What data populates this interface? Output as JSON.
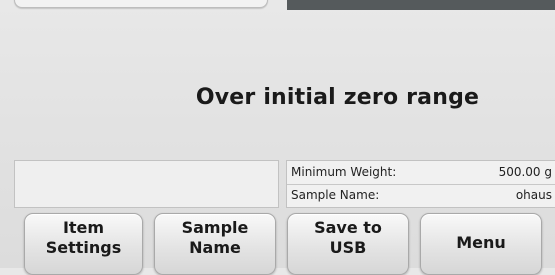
{
  "message": "Over initial zero range",
  "info": {
    "min_weight_label": "Minimum Weight:",
    "min_weight_value": "500.00 g",
    "sample_name_label": "Sample Name:",
    "sample_name_value": "ohaus"
  },
  "buttons": {
    "item_settings": "Item\nSettings",
    "sample_name": "Sample\nName",
    "save_usb": "Save to\nUSB",
    "menu": "Menu"
  }
}
